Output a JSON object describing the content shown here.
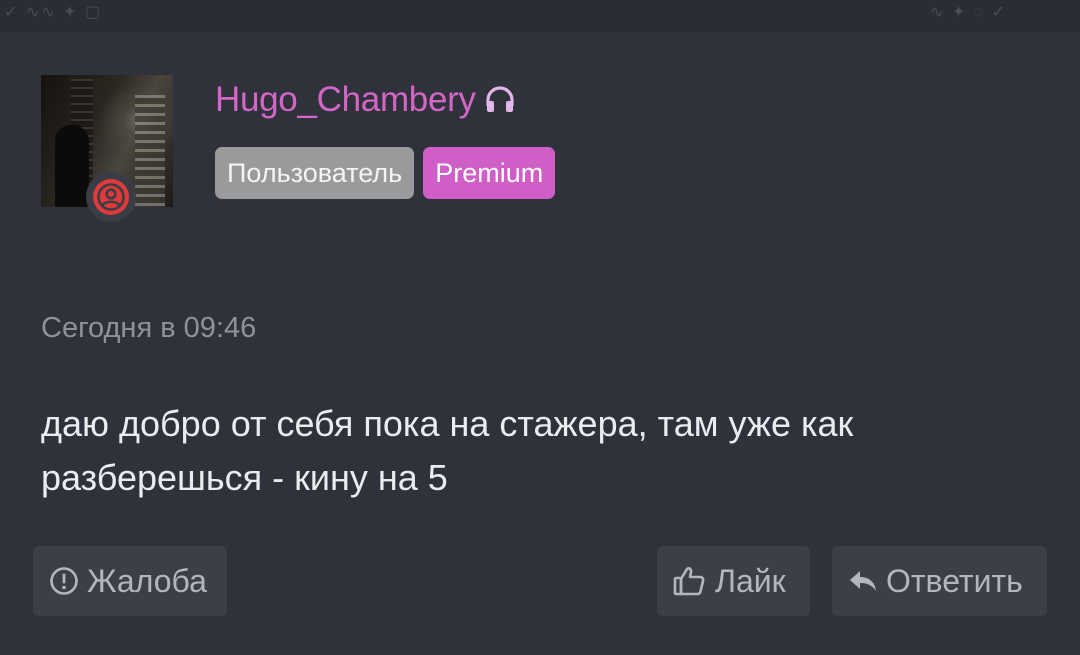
{
  "post": {
    "author": {
      "username": "Hugo_Chambery",
      "username_color": "#d466c8",
      "badge_icon": "headphones-icon",
      "status_icon": "user-offline-icon",
      "status_color": "#e03a3a",
      "tags": [
        {
          "label": "Пользователь",
          "color": "#9a9a9c"
        },
        {
          "label": "Premium",
          "color": "#cf5ec7"
        }
      ]
    },
    "timestamp": "Сегодня в 09:46",
    "message": "даю добро от себя пока на стажера, там уже как разберешься - кину на 5"
  },
  "actions": {
    "report_label": "Жалоба",
    "report_icon": "exclamation-circle-icon",
    "like_label": "Лайк",
    "like_icon": "thumbs-up-icon",
    "reply_label": "Ответить",
    "reply_icon": "reply-arrow-icon"
  }
}
